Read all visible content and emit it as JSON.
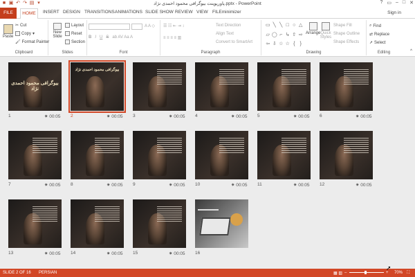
{
  "window": {
    "title": "پاورپوینت بیوگرافی محمود احمدی نژاد.pptx - PowerPoint",
    "sign_in": "Sign in"
  },
  "tabs": [
    "FILE",
    "HOME",
    "INSERT",
    "DESIGN",
    "TRANSITIONS",
    "ANIMATIONS",
    "SLIDE SHOW",
    "REVIEW",
    "VIEW",
    "FILEminimizer"
  ],
  "ribbon": {
    "clipboard": {
      "paste": "Paste",
      "cut": "Cut",
      "copy": "Copy",
      "format_painter": "Format Painter",
      "label": "Clipboard"
    },
    "slides": {
      "new_slide": "New Slide",
      "layout": "Layout",
      "reset": "Reset",
      "section": "Section",
      "label": "Slides"
    },
    "font": {
      "label": "Font"
    },
    "paragraph": {
      "text_direction": "Text Direction",
      "align_text": "Align Text",
      "convert": "Convert to SmartArt",
      "label": "Paragraph"
    },
    "drawing": {
      "arrange": "Arrange",
      "quick_styles": "Quick Styles",
      "shape_fill": "Shape Fill",
      "shape_outline": "Shape Outline",
      "shape_effects": "Shape Effects",
      "label": "Drawing"
    },
    "editing": {
      "find": "Find",
      "replace": "Replace",
      "select": "Select",
      "label": "Editing"
    }
  },
  "slides": [
    {
      "num": "1",
      "time": "00:05",
      "title": "بیوگرافی محمود احمدی نژاد"
    },
    {
      "num": "2",
      "time": "00:05",
      "title": "بیوگرافی محمود احمدی نژاد",
      "selected": true
    },
    {
      "num": "3",
      "time": "00:05"
    },
    {
      "num": "4",
      "time": "00:05"
    },
    {
      "num": "5",
      "time": "00:05"
    },
    {
      "num": "6",
      "time": "00:05"
    },
    {
      "num": "7",
      "time": "00:05"
    },
    {
      "num": "8",
      "time": "00:05"
    },
    {
      "num": "9",
      "time": "00:05"
    },
    {
      "num": "10",
      "time": "00:05"
    },
    {
      "num": "11",
      "time": "00:05"
    },
    {
      "num": "12",
      "time": "00:05"
    },
    {
      "num": "13",
      "time": "00:05"
    },
    {
      "num": "14",
      "time": "00:05"
    },
    {
      "num": "15",
      "time": "00:05"
    },
    {
      "num": "16",
      "time": ""
    }
  ],
  "status": {
    "slide": "SLIDE 2 OF 16",
    "language": "PERSIAN",
    "zoom": "70%"
  },
  "colors": {
    "accent": "#d24726",
    "file_tab": "#c43e1c"
  }
}
